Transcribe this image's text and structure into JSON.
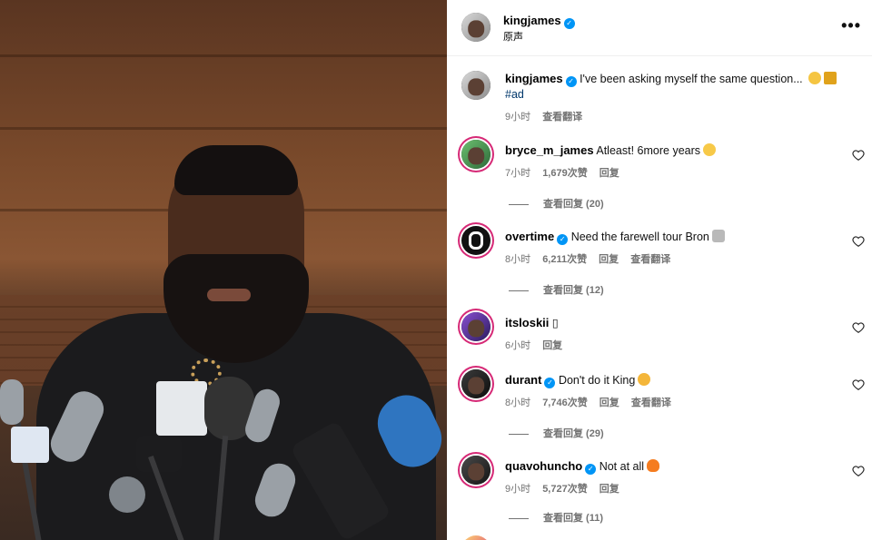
{
  "post": {
    "author": "kingjames",
    "audio": "原声",
    "more_label": "•••"
  },
  "caption": {
    "author": "kingjames",
    "text": "I've been asking myself the same question...",
    "hashtag": "#ad",
    "time": "9小时",
    "translate": "查看翻译"
  },
  "comments": [
    {
      "author": "bryce_m_james",
      "verified": false,
      "text": "Atleast! 6more years",
      "time": "7小时",
      "likes": "1,679次赞",
      "reply": "回复",
      "translate": "",
      "view_replies": "查看回复 (20)"
    },
    {
      "author": "overtime",
      "verified": true,
      "text": "Need the farewell tour Bron",
      "time": "8小时",
      "likes": "6,211次赞",
      "reply": "回复",
      "translate": "查看翻译",
      "view_replies": "查看回复 (12)"
    },
    {
      "author": "itsloskii",
      "verified": false,
      "text": "▯",
      "time": "6小时",
      "likes": "",
      "reply": "回复",
      "translate": "",
      "view_replies": ""
    },
    {
      "author": "durant",
      "verified": true,
      "text": "Don't do it King",
      "time": "8小时",
      "likes": "7,746次赞",
      "reply": "回复",
      "translate": "查看翻译",
      "view_replies": "查看回复 (29)"
    },
    {
      "author": "quavohuncho",
      "verified": true,
      "text": "Not at all",
      "time": "9小时",
      "likes": "5,727次赞",
      "reply": "回复",
      "translate": "",
      "view_replies": "查看回复 (11)"
    }
  ],
  "colors": {
    "verified": "#0095f6",
    "muted": "#737373",
    "hashtag": "#00376b",
    "ring": "#d62976"
  },
  "icons": {
    "verified": "check-badge",
    "heart": "heart-outline",
    "more": "ellipsis"
  }
}
